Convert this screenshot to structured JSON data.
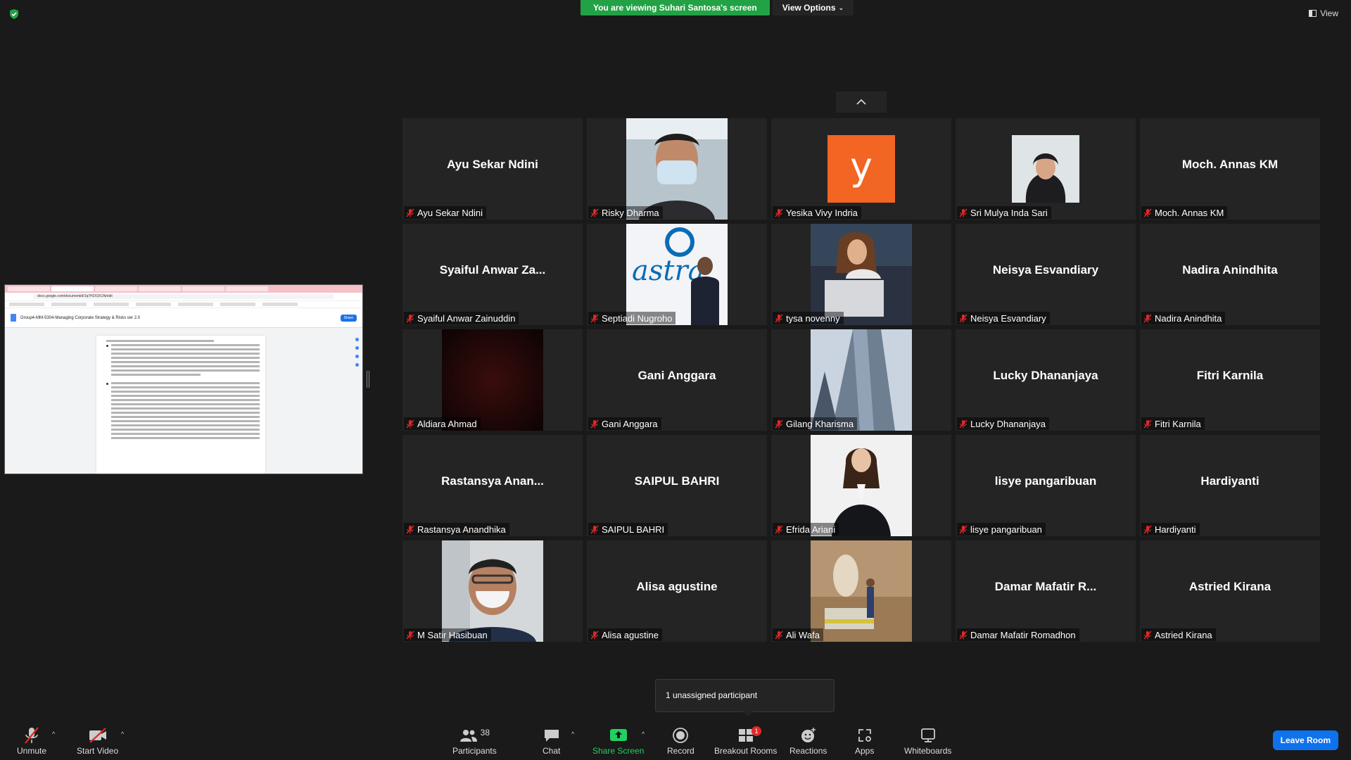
{
  "banner": {
    "viewing_text": "You are viewing Suhari Santosa's screen",
    "view_options_label": "View Options",
    "view_label": "View"
  },
  "shared_screen": {
    "url": "docs.google.com/document/d/1q7H2X3X1N/edit",
    "doc_title": "Group4-MM-5304-Managing Corporate Strategy & Risks ver 2.0",
    "share_label": "Share"
  },
  "participants": [
    {
      "name": "Ayu Sekar Ndini",
      "display": "Ayu Sekar Ndini",
      "video": "none"
    },
    {
      "name": "Risky Dharma",
      "display": "Risky Dharma",
      "video": "photo-mask"
    },
    {
      "name": "Yesika Vivy Indria",
      "display": "y",
      "video": "avatar-letter"
    },
    {
      "name": "Sri Mulya Inda Sari",
      "display": "Sri Mulya Inda Sari",
      "video": "photo-hijab"
    },
    {
      "name": "Moch. Annas KM",
      "display": "Moch. Annas KM",
      "video": "none"
    },
    {
      "name": "Syaiful Anwar Zainuddin",
      "display": "Syaiful  Anwar  Za...",
      "video": "none"
    },
    {
      "name": "Septiadi Nugroho",
      "display": "Septiadi Nugroho",
      "video": "photo-astra"
    },
    {
      "name": "tysa novenny",
      "display": "tysa novenny",
      "video": "photo-laptop"
    },
    {
      "name": "Neisya Esvandiary",
      "display": "Neisya Esvandiary",
      "video": "none"
    },
    {
      "name": "Nadira Anindhita",
      "display": "Nadira Anindhita",
      "video": "none"
    },
    {
      "name": "Aldiara Ahmad",
      "display": "Aldiara Ahmad",
      "video": "photo-dark"
    },
    {
      "name": "Gani Anggara",
      "display": "Gani Anggara",
      "video": "none"
    },
    {
      "name": "Gilang Kharisma",
      "display": "Gilang Kharisma",
      "video": "photo-building"
    },
    {
      "name": "Lucky Dhananjaya",
      "display": "Lucky Dhananjaya",
      "video": "none"
    },
    {
      "name": "Fitri Karnila",
      "display": "Fitri Karnila",
      "video": "none"
    },
    {
      "name": "Rastansya Anandhika",
      "display": "Rastansya  Anan...",
      "video": "none"
    },
    {
      "name": "SAIPUL BAHRI",
      "display": "SAIPUL BAHRI",
      "video": "none"
    },
    {
      "name": "Efrida Ariani",
      "display": "Efrida Ariani",
      "video": "photo-presenter"
    },
    {
      "name": "lisye pangaribuan",
      "display": "lisye pangaribuan",
      "video": "none"
    },
    {
      "name": "Hardiyanti",
      "display": "Hardiyanti",
      "video": "none"
    },
    {
      "name": "M Satir Hasibuan",
      "display": "M Satir Hasibuan",
      "video": "photo-man-mask"
    },
    {
      "name": "Alisa agustine",
      "display": "Alisa agustine",
      "video": "none"
    },
    {
      "name": "Ali Wafa",
      "display": "Ali Wafa",
      "video": "photo-statue"
    },
    {
      "name": "Damar Mafatir Romadhon",
      "display": "Damar  Mafatir  R...",
      "video": "none"
    },
    {
      "name": "Astried Kirana",
      "display": "Astried Kirana",
      "video": "none"
    }
  ],
  "popup": {
    "text": "1 unassigned participant"
  },
  "toolbar": {
    "unmute": "Unmute",
    "start_video": "Start Video",
    "participants": "Participants",
    "participants_count": "38",
    "chat": "Chat",
    "share_screen": "Share Screen",
    "record": "Record",
    "breakout_rooms": "Breakout Rooms",
    "breakout_badge": "1",
    "reactions": "Reactions",
    "apps": "Apps",
    "whiteboards": "Whiteboards",
    "leave": "Leave Room"
  },
  "colors": {
    "banner_green": "#23a245",
    "leave_blue": "#0e72ed",
    "tile_bg": "#242424",
    "muted_red": "#e02828",
    "avatar_orange": "#f26522"
  }
}
